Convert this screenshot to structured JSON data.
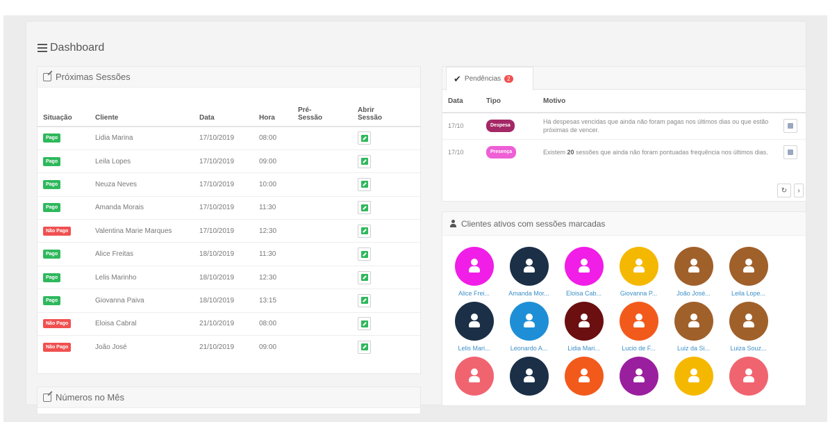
{
  "dashboard": {
    "title": "Dashboard"
  },
  "sessions": {
    "title": "Próximas Sessões",
    "headers": {
      "status": "Situação",
      "client": "Cliente",
      "date": "Data",
      "hour": "Hora",
      "pre": "Pré-\nSessão",
      "open": "Abrir\nSessão"
    },
    "rows": [
      {
        "status": "Pago",
        "paid": true,
        "client": "Lidia Marina",
        "date": "17/10/2019",
        "hour": "08:00"
      },
      {
        "status": "Pago",
        "paid": true,
        "client": "Leila Lopes",
        "date": "17/10/2019",
        "hour": "09:00"
      },
      {
        "status": "Pago",
        "paid": true,
        "client": "Neuza Neves",
        "date": "17/10/2019",
        "hour": "10:00"
      },
      {
        "status": "Pago",
        "paid": true,
        "client": "Amanda Morais",
        "date": "17/10/2019",
        "hour": "11:30"
      },
      {
        "status": "Não Pago",
        "paid": false,
        "client": "Valentina Marie Marques",
        "date": "17/10/2019",
        "hour": "12:30"
      },
      {
        "status": "Pago",
        "paid": true,
        "client": "Alice Freitas",
        "date": "18/10/2019",
        "hour": "11:30"
      },
      {
        "status": "Pago",
        "paid": true,
        "client": "Lelis Marinho",
        "date": "18/10/2019",
        "hour": "12:30"
      },
      {
        "status": "Pago",
        "paid": true,
        "client": "Giovanna Paiva",
        "date": "18/10/2019",
        "hour": "13:15"
      },
      {
        "status": "Não Pago",
        "paid": false,
        "client": "Eloisa Cabral",
        "date": "21/10/2019",
        "hour": "08:00"
      },
      {
        "status": "Não Pago",
        "paid": false,
        "client": "João José",
        "date": "21/10/2019",
        "hour": "09:00"
      }
    ]
  },
  "numbers": {
    "title": "Números no Mês"
  },
  "pending": {
    "tab_label": "Pendências",
    "tab_count": "2",
    "headers": {
      "date": "Data",
      "type": "Tipo",
      "reason": "Motivo"
    },
    "rows": [
      {
        "date": "17/10",
        "type": "Despesa",
        "reason_pre": "Há despesas vencidas que ainda não foram pagas nos últimos dias ou que estão próximas de vencer.",
        "reason_bold": "",
        "reason_post": ""
      },
      {
        "date": "17/10",
        "type": "Presença",
        "reason_pre": "Existem ",
        "reason_bold": "20",
        "reason_post": " sessões que ainda não foram pontuadas frequência nos últimos dias."
      }
    ]
  },
  "clients": {
    "title": "Clientes ativos com sessões marcadas",
    "items": [
      {
        "name": "Alice Frei...",
        "color": "#f01ee6"
      },
      {
        "name": "Amanda Mor...",
        "color": "#1b2f47"
      },
      {
        "name": "Eloisa Cab...",
        "color": "#f01ee6"
      },
      {
        "name": "Giovanna P...",
        "color": "#f5b800"
      },
      {
        "name": "João José...",
        "color": "#a0602a"
      },
      {
        "name": "Leila Lope...",
        "color": "#a0602a"
      },
      {
        "name": "Lelis Mari...",
        "color": "#1b2f47"
      },
      {
        "name": "Leonardo A...",
        "color": "#1e8fd6"
      },
      {
        "name": "Lidia Mari...",
        "color": "#6b0f10"
      },
      {
        "name": "Lucio de F...",
        "color": "#f25a1c"
      },
      {
        "name": "Luiz da Si...",
        "color": "#a0602a"
      },
      {
        "name": "Luiza Souz...",
        "color": "#a0602a"
      },
      {
        "name": "",
        "color": "#f06470"
      },
      {
        "name": "",
        "color": "#1b2f47"
      },
      {
        "name": "",
        "color": "#f25a1c"
      },
      {
        "name": "",
        "color": "#9a1f9e"
      },
      {
        "name": "",
        "color": "#f5b800"
      },
      {
        "name": "",
        "color": "#f06470"
      }
    ]
  }
}
